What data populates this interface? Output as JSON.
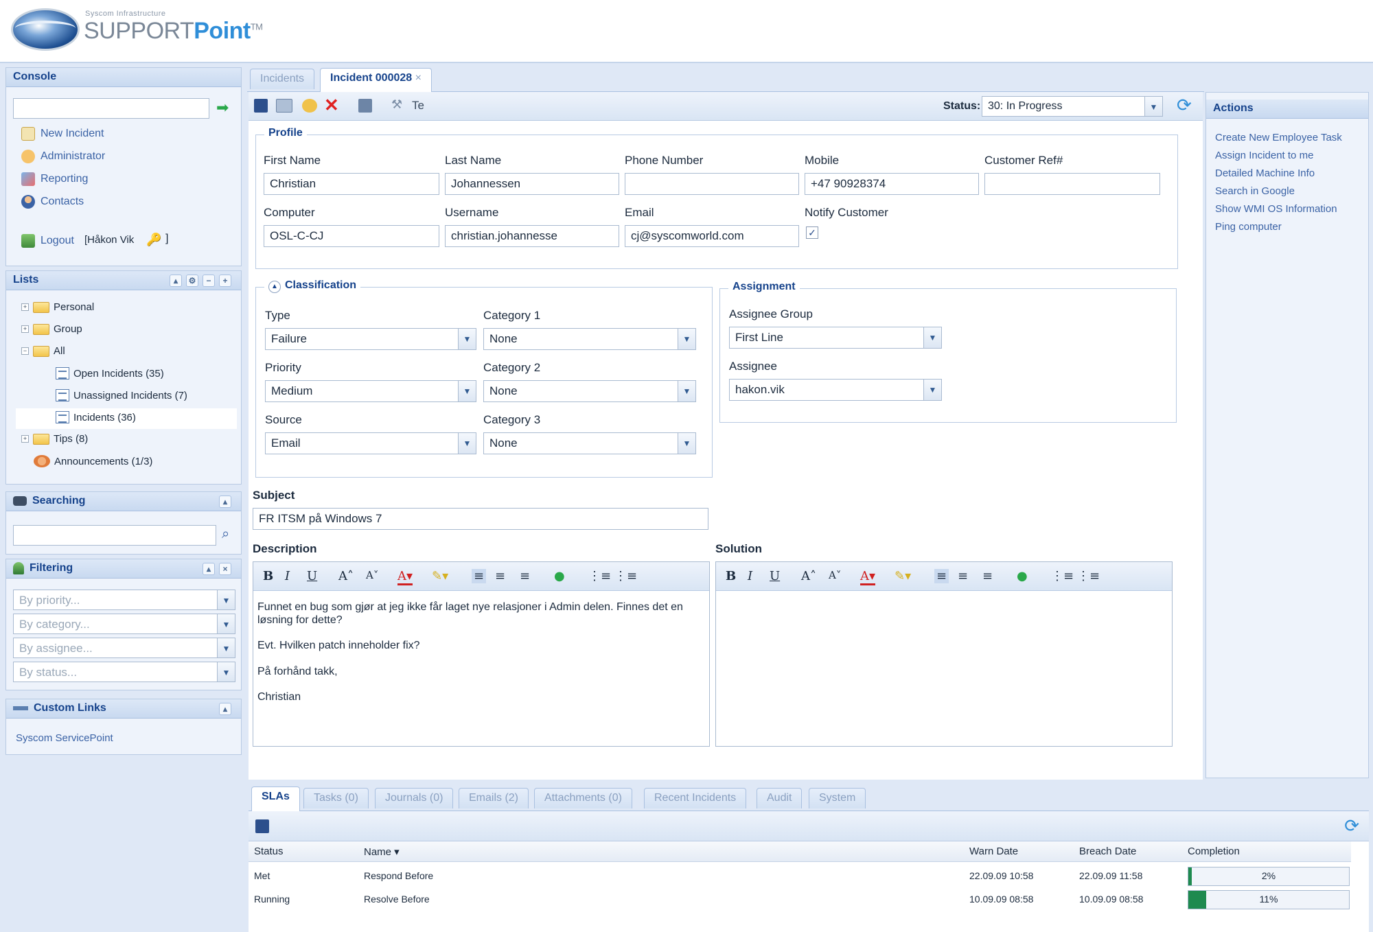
{
  "logo": {
    "subtitle": "Syscom Infrastructure",
    "brand_a": "SUPPORT",
    "brand_b": "Point",
    "tm": "TM"
  },
  "console": {
    "title": "Console",
    "items": [
      {
        "label": "New Incident",
        "icon": "new-incident-icon"
      },
      {
        "label": "Administrator",
        "icon": "administrator-icon"
      },
      {
        "label": "Reporting",
        "icon": "reporting-icon"
      },
      {
        "label": "Contacts",
        "icon": "contacts-icon"
      }
    ],
    "logout": "Logout",
    "user": "[Håkon Vik"
  },
  "lists": {
    "title": "Lists",
    "tree": [
      {
        "label": "Personal",
        "type": "folder",
        "indent": 0
      },
      {
        "label": "Group",
        "type": "folder",
        "indent": 0
      },
      {
        "label": "All",
        "type": "folder",
        "indent": 0
      },
      {
        "label": "Open Incidents (35)",
        "type": "list",
        "indent": 1
      },
      {
        "label": "Unassigned Incidents (7)",
        "type": "list",
        "indent": 1
      },
      {
        "label": "Incidents (36)",
        "type": "list",
        "indent": 1,
        "selected": true
      },
      {
        "label": "Tips (8)",
        "type": "folder",
        "indent": 0
      },
      {
        "label": "Announcements (1/3)",
        "type": "announce",
        "indent": 0
      }
    ]
  },
  "searching": {
    "title": "Searching"
  },
  "filtering": {
    "title": "Filtering",
    "filters": [
      "By priority...",
      "By category...",
      "By assignee...",
      "By status..."
    ]
  },
  "custom_links": {
    "title": "Custom Links",
    "items": [
      "Syscom ServicePoint"
    ]
  },
  "tabs": [
    {
      "label": "Incidents",
      "active": false
    },
    {
      "label": "Incident 000028",
      "active": true
    }
  ],
  "toolbar": {
    "status_label": "Status:",
    "status_value": "30: In Progress"
  },
  "profile": {
    "legend": "Profile",
    "first_name": {
      "label": "First Name",
      "value": "Christian"
    },
    "last_name": {
      "label": "Last Name",
      "value": "Johannessen"
    },
    "phone": {
      "label": "Phone Number",
      "value": ""
    },
    "mobile": {
      "label": "Mobile",
      "value": "+47 90928374"
    },
    "customer_ref": {
      "label": "Customer Ref#",
      "value": ""
    },
    "computer": {
      "label": "Computer",
      "value": "OSL-C-CJ"
    },
    "username": {
      "label": "Username",
      "value": "christian.johannesse"
    },
    "email": {
      "label": "Email",
      "value": "cj@syscomworld.com"
    },
    "notify": {
      "label": "Notify Customer",
      "checked": true
    }
  },
  "classification": {
    "legend": "Classification",
    "type": {
      "label": "Type",
      "value": "Failure"
    },
    "priority": {
      "label": "Priority",
      "value": "Medium"
    },
    "source": {
      "label": "Source",
      "value": "Email"
    },
    "category1": {
      "label": "Category 1",
      "value": "None"
    },
    "category2": {
      "label": "Category 2",
      "value": "None"
    },
    "category3": {
      "label": "Category 3",
      "value": "None"
    }
  },
  "assignment": {
    "legend": "Assignment",
    "group": {
      "label": "Assignee Group",
      "value": "First Line"
    },
    "assignee": {
      "label": "Assignee",
      "value": "hakon.vik"
    }
  },
  "subject": {
    "label": "Subject",
    "value": "FR ITSM på Windows 7"
  },
  "description": {
    "label": "Description",
    "paragraphs": [
      "Funnet en bug som gjør at jeg ikke får laget nye relasjoner i Admin delen. Finnes det en løsning for dette?",
      "Evt. Hvilken patch inneholder fix?",
      "På forhånd takk,",
      "Christian"
    ]
  },
  "solution": {
    "label": "Solution"
  },
  "actions": {
    "title": "Actions",
    "items": [
      "Create New Employee Task",
      "Assign Incident to me",
      "Detailed Machine Info",
      "Search in Google",
      "Show WMI OS Information",
      "Ping computer"
    ]
  },
  "bottom_tabs": [
    "SLAs",
    "Tasks (0)",
    "Journals (0)",
    "Emails (2)",
    "Attachments (0)",
    "Recent Incidents",
    "Audit",
    "System"
  ],
  "sla_grid": {
    "headers": [
      "Status",
      "Name ▾",
      "Warn Date",
      "Breach Date",
      "Completion"
    ],
    "rows": [
      {
        "status": "Met",
        "name": "Respond Before",
        "warn": "22.09.09 10:58",
        "breach": "22.09.09 11:58",
        "completion_label": "2%",
        "completion": 0.02
      },
      {
        "status": "Running",
        "name": "Resolve Before",
        "warn": "10.09.09 08:58",
        "breach": "10.09.09 08:58",
        "completion_label": "11%",
        "completion": 0.11
      }
    ]
  },
  "colors": {
    "accent": "#15428b",
    "link": "#3a62a5",
    "panel_bg": "#eef3fb",
    "progress": "#1e8a4f"
  }
}
